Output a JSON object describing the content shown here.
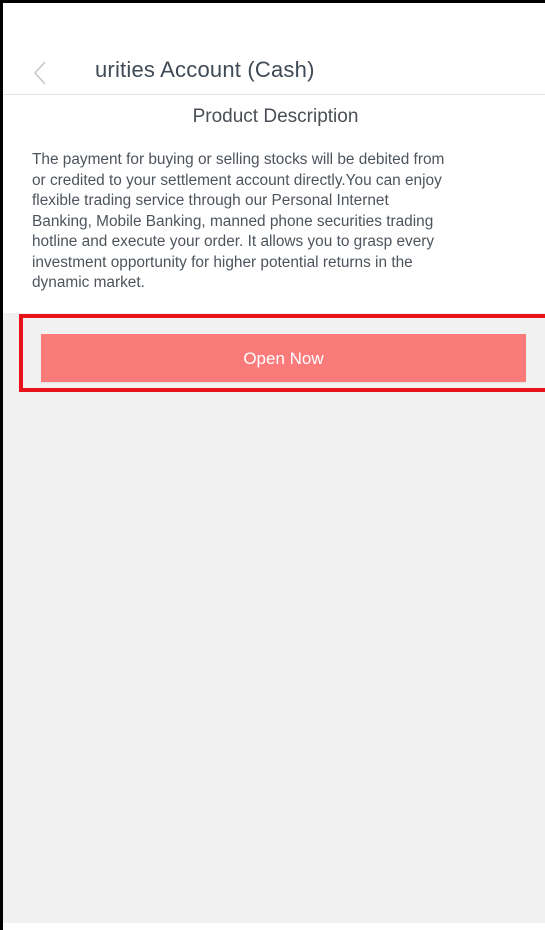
{
  "header": {
    "title": "urities Account (Cash)",
    "back_icon": "chevron-left-icon"
  },
  "section": {
    "title": "Product Description"
  },
  "description": {
    "lines": [
      "The payment for buying or selling stocks will be debited from",
      "or credited to your settlement account directly.You can enjoy",
      "flexible trading service through our Personal Internet",
      "Banking, Mobile Banking, manned phone securities trading",
      "hotline and execute your order. It allows you to grasp every",
      "investment opportunity for higher potential returns in the",
      "dynamic market."
    ]
  },
  "actions": {
    "open_label": "Open Now"
  },
  "colors": {
    "button_bg": "#fb7b7b",
    "highlight_border": "#e8121b",
    "page_bg": "#f1f1f1"
  }
}
